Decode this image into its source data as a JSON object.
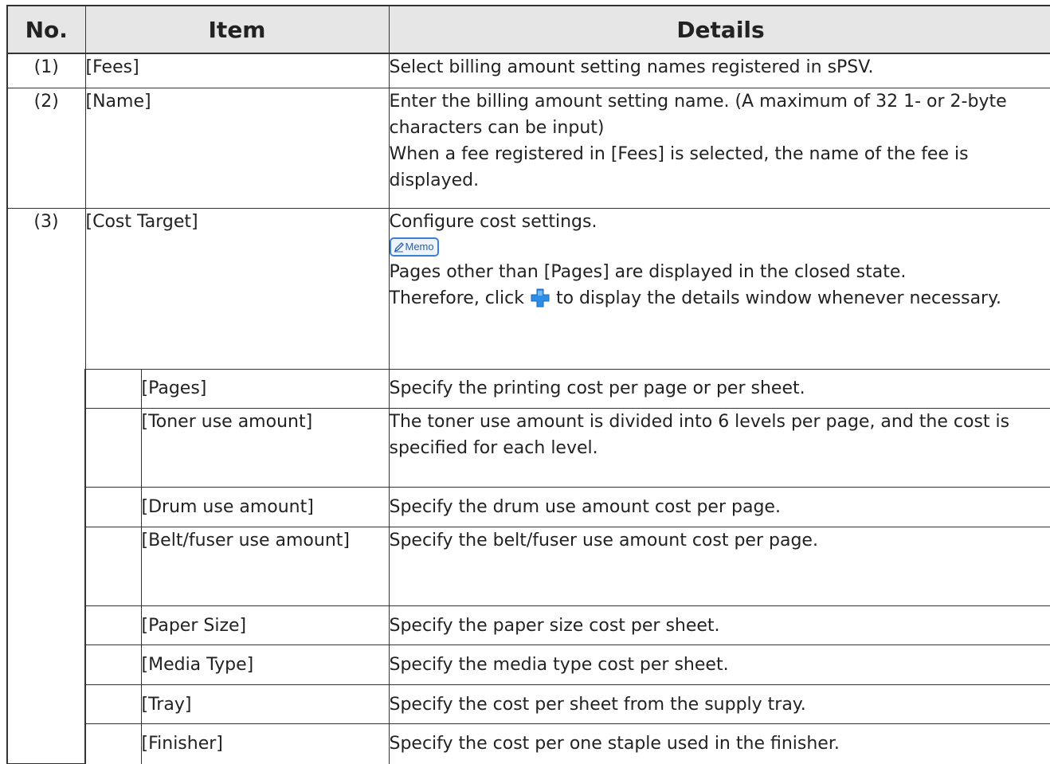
{
  "headers": {
    "no": "No.",
    "item": "Item",
    "details": "Details"
  },
  "rows": [
    {
      "no": "(1)",
      "item": "[Fees]",
      "details": [
        "Select billing amount setting names registered in sPSV."
      ]
    },
    {
      "no": "(2)",
      "item": "[Name]",
      "details": [
        "Enter the billing amount setting name. (A maximum of 32 1- or 2-byte characters can be input)",
        "When a fee registered in [Fees] is selected, the name of the fee is displayed."
      ]
    },
    {
      "no": "(3)",
      "item": "[Cost Target]",
      "details": [
        "Configure cost settings.",
        "Pages other than [Pages] are displayed in the closed state.",
        "Therefore, click",
        "to display the details window whenever necessary."
      ],
      "memo_label": "Memo",
      "memo_icon": "memo-pencil-icon",
      "inline_icon": "blue-plus-icon"
    }
  ],
  "subrows": [
    {
      "item": "[Pages]",
      "details": "Specify the printing cost per page or per sheet."
    },
    {
      "item": "[Toner use amount]",
      "details": "The toner use amount is divided into 6 levels per page, and the cost is specified for each level."
    },
    {
      "item": "[Drum use amount]",
      "details": "Specify the drum use amount cost per page."
    },
    {
      "item": "[Belt/fuser use amount]",
      "details": "Specify the belt/fuser use amount cost per page."
    },
    {
      "item": "[Paper Size]",
      "details": "Specify the paper size cost per sheet."
    },
    {
      "item": "[Media Type]",
      "details": "Specify the media type cost per sheet."
    },
    {
      "item": "[Tray]",
      "details": "Specify the cost per sheet from the supply tray."
    },
    {
      "item": "[Finisher]",
      "details": "Specify the cost per one staple used in the finisher."
    }
  ],
  "colors": {
    "header_bg": "#e6e6e6",
    "border": "#333333",
    "memo_blue": "#3f7fd6",
    "plus_blue": "#2b8de8"
  }
}
